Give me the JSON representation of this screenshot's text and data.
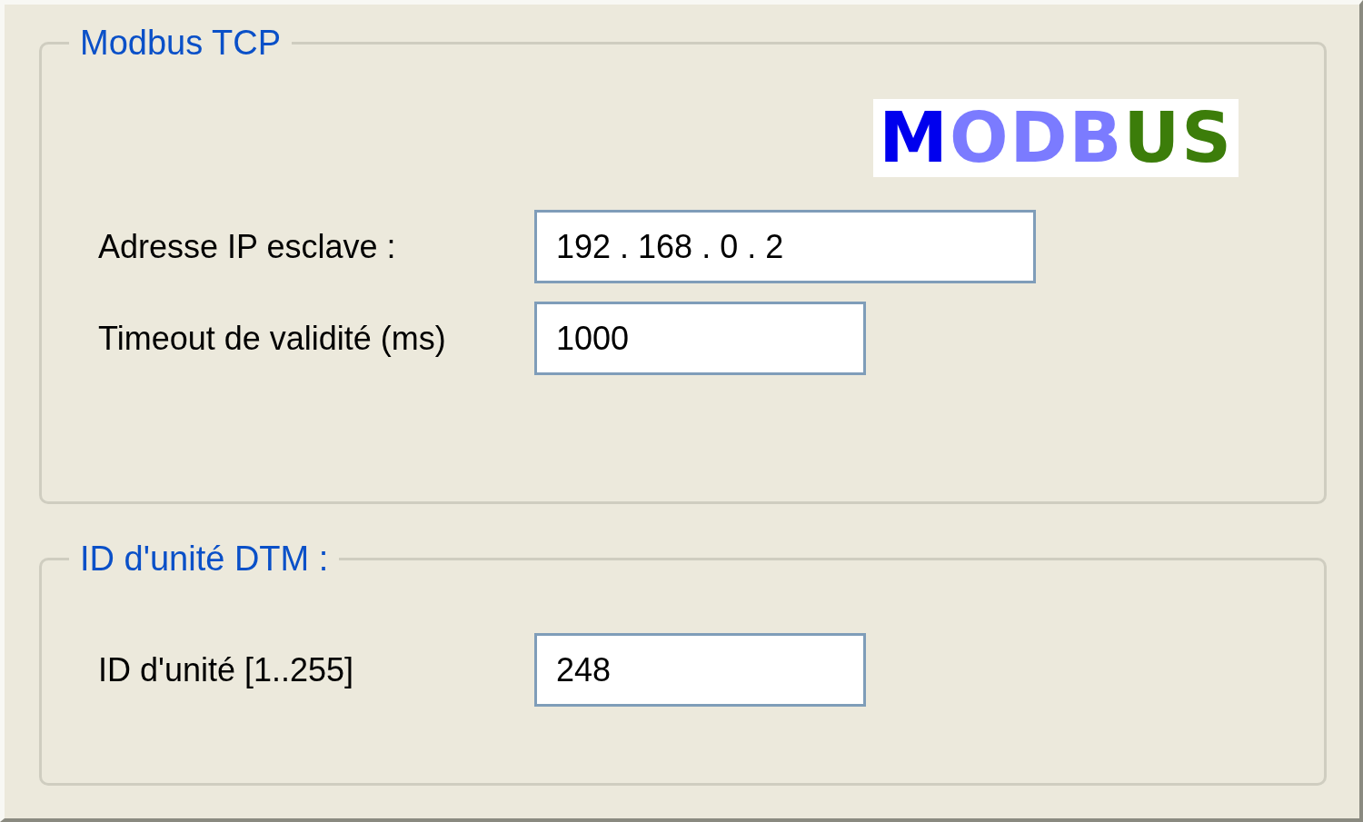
{
  "sections": [
    {
      "title": "Modbus TCP",
      "logo": "MODBUS",
      "fields": [
        {
          "label": "Adresse IP esclave :",
          "value": "192 . 168 . 0 . 2",
          "kind": "wide"
        },
        {
          "label": "Timeout de validité (ms)",
          "value": "1000",
          "kind": "narrow"
        }
      ]
    },
    {
      "title": "ID d'unité DTM :",
      "fields": [
        {
          "label": "ID d'unité [1..255]",
          "value": "248",
          "kind": "narrow"
        }
      ]
    }
  ]
}
